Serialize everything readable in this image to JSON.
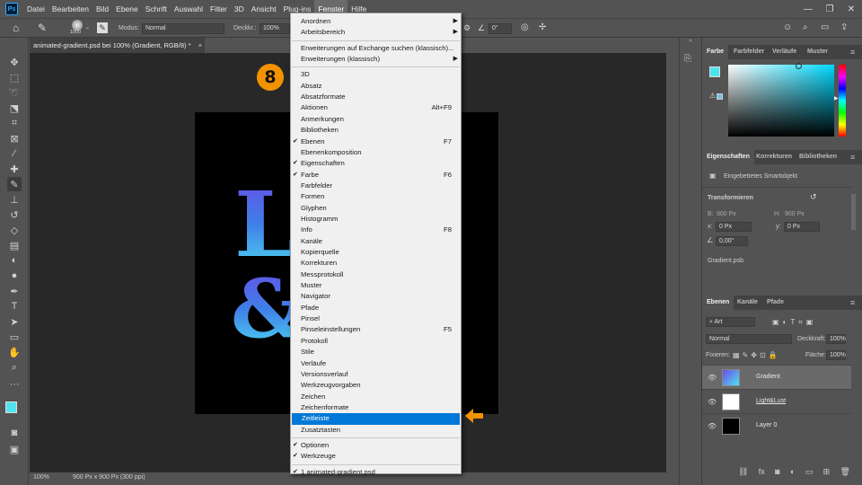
{
  "menubar": {
    "logo": "Ps",
    "items": [
      "Datei",
      "Bearbeiten",
      "Bild",
      "Ebene",
      "Schrift",
      "Auswahl",
      "Filter",
      "3D",
      "Ansicht",
      "Plug-ins",
      "Fenster",
      "Hilfe"
    ],
    "active_index": 10
  },
  "options": {
    "brush_size": "1000",
    "mode_label": "Modus:",
    "mode_value": "Normal",
    "opacity_label": "Deckkr.:",
    "opacity_value": "100%",
    "angle_value": "0°"
  },
  "document": {
    "tab_title": "animated-gradient.psd bei 100% (Gradient, RGB/8) *",
    "canvas_text_top": "L",
    "canvas_text_bottom": "&",
    "status_zoom": "100%",
    "status_info": "900 Px x 900 Px (300 ppi)"
  },
  "badge": {
    "number": "8",
    "color": "#f39200"
  },
  "menu": {
    "rows": [
      {
        "label": "Anordnen",
        "submenu": true
      },
      {
        "label": "Arbeitsbereich",
        "submenu": true
      },
      {
        "sep": true
      },
      {
        "label": "Erweiterungen auf Exchange suchen (klassisch)..."
      },
      {
        "label": "Erweiterungen (klassisch)",
        "submenu": true
      },
      {
        "sep": true
      },
      {
        "label": "3D"
      },
      {
        "label": "Absatz"
      },
      {
        "label": "Absatzformate"
      },
      {
        "label": "Aktionen",
        "shortcut": "Alt+F9"
      },
      {
        "label": "Anmerkungen"
      },
      {
        "label": "Bibliotheken"
      },
      {
        "label": "Ebenen",
        "checked": true,
        "shortcut": "F7"
      },
      {
        "label": "Ebenenkomposition"
      },
      {
        "label": "Eigenschaften",
        "checked": true
      },
      {
        "label": "Farbe",
        "checked": true,
        "shortcut": "F6"
      },
      {
        "label": "Farbfelder"
      },
      {
        "label": "Formen"
      },
      {
        "label": "Glyphen"
      },
      {
        "label": "Histogramm"
      },
      {
        "label": "Info",
        "shortcut": "F8"
      },
      {
        "label": "Kanäle"
      },
      {
        "label": "Kopierquelle"
      },
      {
        "label": "Korrekturen"
      },
      {
        "label": "Messprotokoll"
      },
      {
        "label": "Muster"
      },
      {
        "label": "Navigator"
      },
      {
        "label": "Pfade"
      },
      {
        "label": "Pinsel"
      },
      {
        "label": "Pinseleinstellungen",
        "shortcut": "F5"
      },
      {
        "label": "Protokoll"
      },
      {
        "label": "Stile"
      },
      {
        "label": "Verläufe"
      },
      {
        "label": "Versionsverlauf"
      },
      {
        "label": "Werkzeugvorgaben"
      },
      {
        "label": "Zeichen"
      },
      {
        "label": "Zeichenformate"
      },
      {
        "label": "Zeitleiste",
        "highlighted": true
      },
      {
        "label": "Zusatztasten"
      },
      {
        "sep": true
      },
      {
        "label": "Optionen",
        "checked": true
      },
      {
        "label": "Werkzeuge",
        "checked": true
      },
      {
        "sep": true
      },
      {
        "label": "1 animated-gradient.psd",
        "checked": true
      }
    ]
  },
  "color_panel": {
    "tabs": [
      "Farbe",
      "Farbfelder",
      "Verläufe",
      "Muster"
    ],
    "foreground": "#4fe3f0"
  },
  "properties_panel": {
    "tabs": [
      "Eigenschaften",
      "Korrekturen",
      "Bibliotheken"
    ],
    "type_label": "Eingebettetes Smartobjekt",
    "section": "Transformieren",
    "b_label": "B:",
    "b_value": "900 Px",
    "h_label": "H:",
    "h_value": "900 Px",
    "x_label": "x:",
    "x_value": "0 Px",
    "y_label": "y:",
    "y_value": "0 Px",
    "angle_value": "0,00°",
    "file_name": "Gradient.psb"
  },
  "layers_panel": {
    "tabs": [
      "Ebenen",
      "Kanäle",
      "Pfade"
    ],
    "filter_value": "Art",
    "blend_mode": "Normal",
    "opacity_label": "Deckkraft:",
    "opacity_value": "100%",
    "lock_label": "Fixieren:",
    "fill_label": "Fläche:",
    "fill_value": "100%",
    "layers": [
      {
        "name": "Gradient",
        "selected": true
      },
      {
        "name": "Light&Lust"
      },
      {
        "name": "Layer 0"
      }
    ]
  }
}
